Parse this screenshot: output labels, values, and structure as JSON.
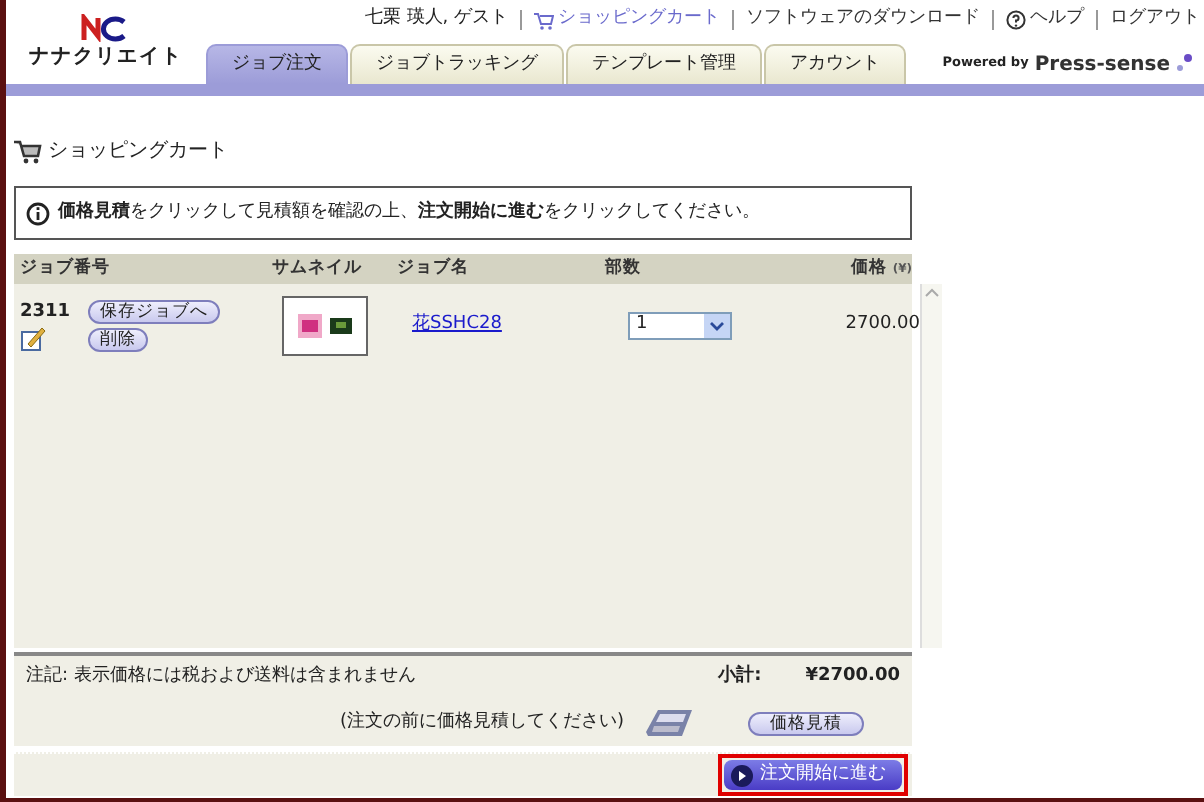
{
  "header": {
    "company": "ナナクリエイト",
    "user": "七栗 瑛人, ゲスト",
    "links": [
      {
        "label": "ショッピングカート",
        "kind": "cart"
      },
      {
        "label": "ソフトウェアのダウンロード",
        "kind": "plain"
      },
      {
        "label": "ヘルプ",
        "kind": "help"
      },
      {
        "label": "ログアウト",
        "kind": "plain"
      }
    ],
    "powered_by": "Powered by",
    "brand": "Press-sense"
  },
  "tabs": [
    {
      "label": "ジョブ注文",
      "selected": true
    },
    {
      "label": "ジョブトラッキング",
      "selected": false
    },
    {
      "label": "テンプレート管理",
      "selected": false
    },
    {
      "label": "アカウント",
      "selected": false
    }
  ],
  "page_title": "ショッピングカート",
  "notice": "**価格見積**をクリックして見積額を確認の上、**注文開始に進む**をクリックしてください。",
  "table": {
    "columns": [
      "ジョブ番号",
      "サムネイル",
      "ジョブ名",
      "部数",
      "価格",
      "(¥)"
    ],
    "rows": [
      {
        "job_number": "2311",
        "buttons": [
          "保存ジョブへ",
          "削除"
        ],
        "job_name": "花SSHC28",
        "copies": "1",
        "price": "2700.00"
      }
    ]
  },
  "footer": {
    "note": "注記: 表示価格には税および送料は含まれません",
    "subtotal_label": "小計:",
    "subtotal": "¥2700.00",
    "hint": "(注文の前に価格見積してください)",
    "estimate_button": "価格見積"
  },
  "proceed_button": "注文開始に進む"
}
